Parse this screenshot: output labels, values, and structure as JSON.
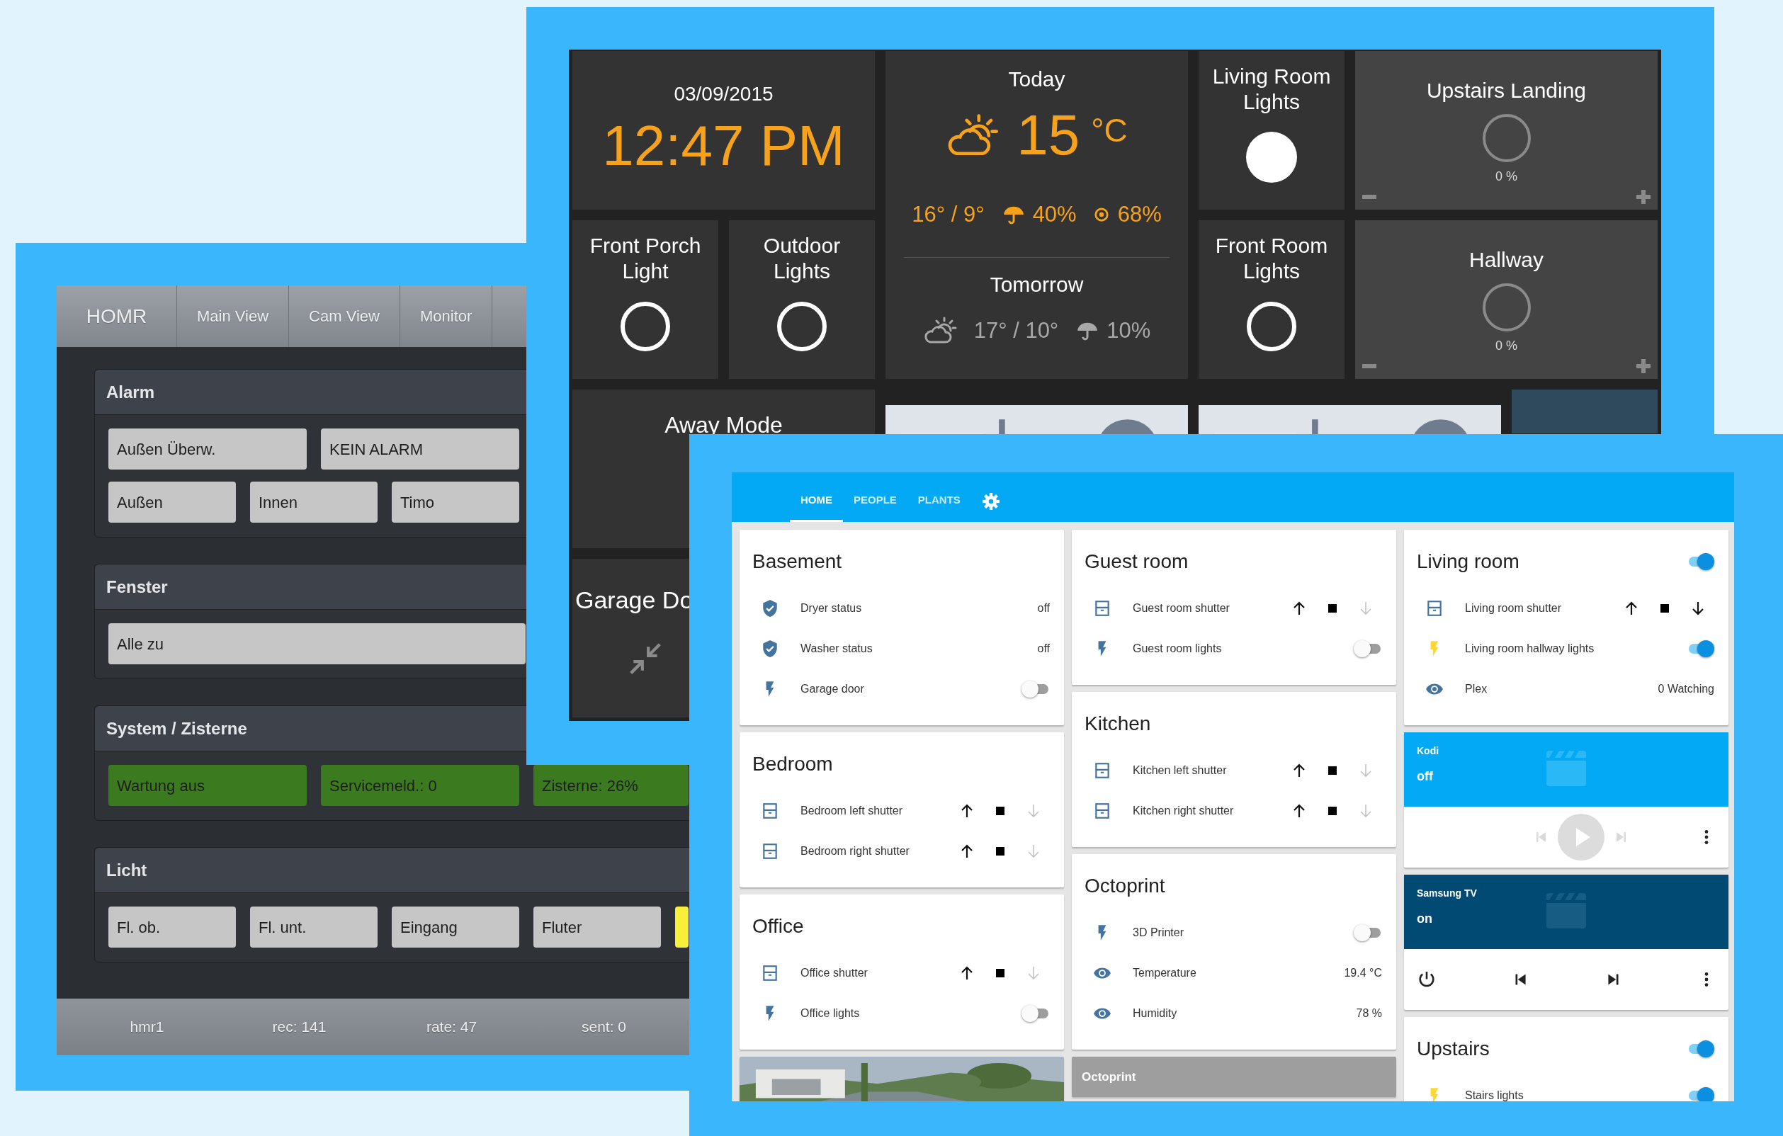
{
  "homr": {
    "brand": "HOMR",
    "tabs": [
      {
        "label": "Main View"
      },
      {
        "label": "Cam View"
      },
      {
        "label": "Monitor"
      }
    ],
    "panels": [
      {
        "title": "Alarm",
        "rows": [
          {
            "kind": "wide",
            "buttons": [
              {
                "label": "Außen Überw.",
                "color": "#c6c6c6"
              },
              {
                "label": "KEIN ALARM",
                "color": "#c6c6c6"
              }
            ]
          },
          {
            "kind": "narrow",
            "buttons": [
              {
                "label": "Außen",
                "color": "#c6c6c6"
              },
              {
                "label": "Innen",
                "color": "#c6c6c6"
              },
              {
                "label": "Timo",
                "color": "#c6c6c6"
              }
            ]
          }
        ]
      },
      {
        "title": "Fenster",
        "rows": [
          {
            "kind": "full",
            "buttons": [
              {
                "label": "Alle zu",
                "color": "#c6c6c6"
              }
            ]
          }
        ]
      },
      {
        "title": "System / Zisterne",
        "rows": [
          {
            "kind": "wide",
            "buttons": [
              {
                "label": "Wartung aus",
                "color": "#3b7a1f"
              },
              {
                "label": "Servicemeld.: 0",
                "color": "#3b7a1f"
              },
              {
                "label": "Zisterne: 26%",
                "color": "#3b7a1f"
              }
            ]
          }
        ]
      },
      {
        "title": "Licht",
        "rows": [
          {
            "kind": "narrow",
            "buttons": [
              {
                "label": "Fl. ob.",
                "color": "#c6c6c6"
              },
              {
                "label": "Fl. unt.",
                "color": "#c6c6c6"
              },
              {
                "label": "Eingang",
                "color": "#c6c6c6"
              },
              {
                "label": "Fluter",
                "color": "#c6c6c6"
              },
              {
                "color": "#f7ef3a"
              }
            ]
          }
        ]
      }
    ],
    "footer": [
      "hmr1",
      "rec: 141",
      "rate: 47",
      "sent: 0"
    ]
  },
  "dashboard": {
    "tiles": [
      {
        "kind": "clock",
        "date": "03/09/2015",
        "time": "12:47 PM"
      },
      {
        "kind": "weather",
        "today": {
          "label": "Today",
          "temp": "15",
          "unit": "°C",
          "range": "16° / 9°",
          "rain": "40%",
          "humidity": "68%"
        },
        "tomorrow": {
          "label": "Tomorrow",
          "range": "17° / 10°",
          "rain": "10%"
        }
      },
      {
        "kind": "light",
        "title": "Living Room Lights",
        "on": true
      },
      {
        "kind": "dimmer",
        "title": "Upstairs Landing",
        "value": "0 %"
      },
      {
        "kind": "light",
        "title": "Front Porch Light",
        "on": false
      },
      {
        "kind": "light",
        "title": "Outdoor Lights",
        "on": false
      },
      {
        "kind": "light",
        "title": "Front Room Lights",
        "on": false
      },
      {
        "kind": "dimmer",
        "title": "Hallway",
        "value": "0 %"
      },
      {
        "kind": "mode",
        "title": "Away Mode"
      },
      {
        "kind": "camera"
      },
      {
        "kind": "camera"
      },
      {
        "kind": "blank"
      },
      {
        "kind": "door",
        "title": "Garage Do"
      }
    ]
  },
  "home_assistant": {
    "tabs": [
      {
        "label": "HOME",
        "selected": true
      },
      {
        "label": "PEOPLE",
        "selected": false
      },
      {
        "label": "PLANTS",
        "selected": false
      }
    ],
    "columns": [
      [
        {
          "kind": "entities",
          "title": "Basement",
          "entities": [
            {
              "kind": "binary_sensor",
              "name": "Dryer status",
              "value": "off"
            },
            {
              "kind": "binary_sensor",
              "name": "Washer status",
              "value": "off"
            },
            {
              "kind": "switch",
              "name": "Garage door",
              "on": false
            }
          ]
        },
        {
          "kind": "entities",
          "title": "Bedroom",
          "entities": [
            {
              "kind": "cover",
              "name": "Bedroom left shutter",
              "down_disabled": true
            },
            {
              "kind": "cover",
              "name": "Bedroom right shutter",
              "down_disabled": true
            }
          ]
        },
        {
          "kind": "entities",
          "title": "Office",
          "entities": [
            {
              "kind": "cover",
              "name": "Office shutter",
              "down_disabled": true
            },
            {
              "kind": "switch",
              "name": "Office lights",
              "on": false
            }
          ]
        },
        {
          "kind": "camera"
        }
      ],
      [
        {
          "kind": "entities",
          "title": "Guest room",
          "entities": [
            {
              "kind": "cover",
              "name": "Guest room shutter",
              "down_disabled": true
            },
            {
              "kind": "switch",
              "name": "Guest room lights",
              "on": false
            }
          ]
        },
        {
          "kind": "entities",
          "title": "Kitchen",
          "entities": [
            {
              "kind": "cover",
              "name": "Kitchen left shutter",
              "down_disabled": true
            },
            {
              "kind": "cover",
              "name": "Kitchen right shutter",
              "down_disabled": true
            }
          ]
        },
        {
          "kind": "entities",
          "title": "Octoprint",
          "entities": [
            {
              "kind": "switch",
              "name": "3D Printer",
              "on": false
            },
            {
              "kind": "sensor",
              "name": "Temperature",
              "value": "19.4 °C"
            },
            {
              "kind": "sensor",
              "name": "Humidity",
              "value": "78 %"
            }
          ]
        },
        {
          "kind": "iframe",
          "title": "Octoprint"
        }
      ],
      [
        {
          "kind": "entities",
          "title": "Living room",
          "on": true,
          "entities": [
            {
              "kind": "cover",
              "name": "Living room shutter",
              "down_disabled": false
            },
            {
              "kind": "switch",
              "name": "Living room hallway lights",
              "on": true
            },
            {
              "kind": "sensor",
              "name": "Plex",
              "value": "0 Watching"
            }
          ]
        },
        {
          "kind": "media",
          "name": "Kodi",
          "state": "off",
          "on": false
        },
        {
          "kind": "media",
          "name": "Samsung TV",
          "state": "on",
          "on": true
        },
        {
          "kind": "entities",
          "title": "Upstairs",
          "on": true,
          "entities": [
            {
              "kind": "switch",
              "name": "Stairs lights",
              "on": true
            }
          ]
        }
      ]
    ]
  }
}
